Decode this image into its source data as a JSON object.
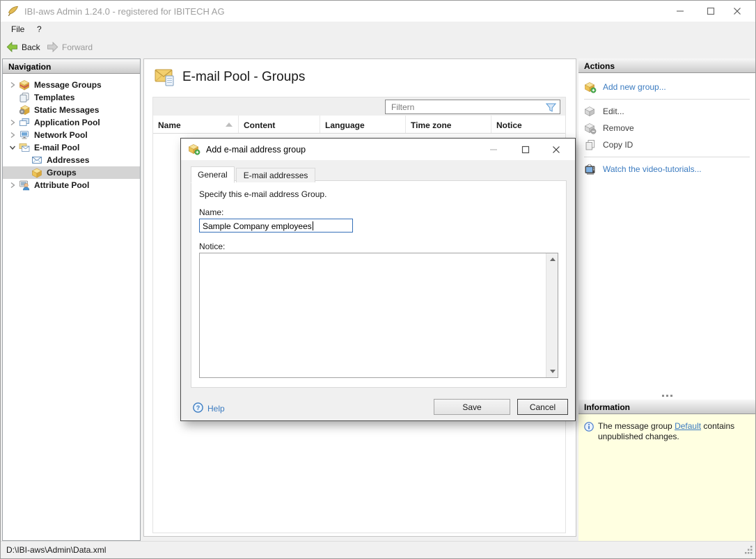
{
  "window": {
    "title": "IBI-aws Admin 1.24.0 - registered for IBITECH AG",
    "status_text": "D:\\IBI-aws\\Admin\\Data.xml"
  },
  "menu": {
    "items": [
      {
        "label": "File"
      },
      {
        "label": "?"
      }
    ]
  },
  "toolbar": {
    "back_label": "Back",
    "forward_label": "Forward"
  },
  "navigation": {
    "header": "Navigation",
    "items": [
      {
        "label": "Message Groups",
        "icon": "message-groups-icon",
        "state": "collapsed",
        "level": 0,
        "selected": false
      },
      {
        "label": "Templates",
        "icon": "templates-icon",
        "state": "none",
        "level": 0,
        "selected": false
      },
      {
        "label": "Static Messages",
        "icon": "static-messages-icon",
        "state": "none",
        "level": 0,
        "selected": false
      },
      {
        "label": "Application Pool",
        "icon": "application-pool-icon",
        "state": "collapsed",
        "level": 0,
        "selected": false
      },
      {
        "label": "Network Pool",
        "icon": "network-pool-icon",
        "state": "collapsed",
        "level": 0,
        "selected": false
      },
      {
        "label": "E-mail Pool",
        "icon": "email-pool-icon",
        "state": "expanded",
        "level": 0,
        "selected": false
      },
      {
        "label": "Addresses",
        "icon": "addresses-icon",
        "state": "none",
        "level": 1,
        "selected": false
      },
      {
        "label": "Groups",
        "icon": "groups-icon",
        "state": "none",
        "level": 1,
        "selected": true
      },
      {
        "label": "Attribute Pool",
        "icon": "attribute-pool-icon",
        "state": "collapsed",
        "level": 0,
        "selected": false
      }
    ]
  },
  "main": {
    "title": "E-mail Pool - Groups",
    "filter_placeholder": "Filtern",
    "columns": [
      {
        "label": "Name",
        "sorted": "asc"
      },
      {
        "label": "Content",
        "sorted": "none"
      },
      {
        "label": "Language",
        "sorted": "none"
      },
      {
        "label": "Time zone",
        "sorted": "none"
      },
      {
        "label": "Notice",
        "sorted": "none"
      }
    ]
  },
  "actions": {
    "header": "Actions",
    "items": [
      {
        "label": "Add new group...",
        "icon": "add-group-icon",
        "enabled": true
      },
      {
        "label": "Edit...",
        "icon": "edit-group-icon",
        "enabled": false
      },
      {
        "label": "Remove",
        "icon": "remove-group-icon",
        "enabled": false
      },
      {
        "label": "Copy ID",
        "icon": "copy-id-icon",
        "enabled": false
      },
      {
        "label": "Watch the video-tutorials...",
        "icon": "video-tutorials-icon",
        "enabled": true
      }
    ]
  },
  "information": {
    "header": "Information",
    "message_before": "The message group ",
    "message_link": "Default",
    "message_after": " contains unpublished changes."
  },
  "dialog": {
    "title": "Add e-mail address group",
    "tabs": [
      {
        "label": "General",
        "active": true
      },
      {
        "label": "E-mail addresses",
        "active": false
      }
    ],
    "description": "Specify this e-mail address Group.",
    "name_label": "Name:",
    "name_value": "Sample Company employees",
    "notice_label": "Notice:",
    "notice_value": "",
    "help_label": "Help",
    "save_label": "Save",
    "cancel_label": "Cancel"
  },
  "icons": {
    "sort_ascending": "triangle-up",
    "splitter_dots": "ellipsis",
    "chevron_collapsed": "chevron-right",
    "chevron_expanded": "chevron-down"
  }
}
